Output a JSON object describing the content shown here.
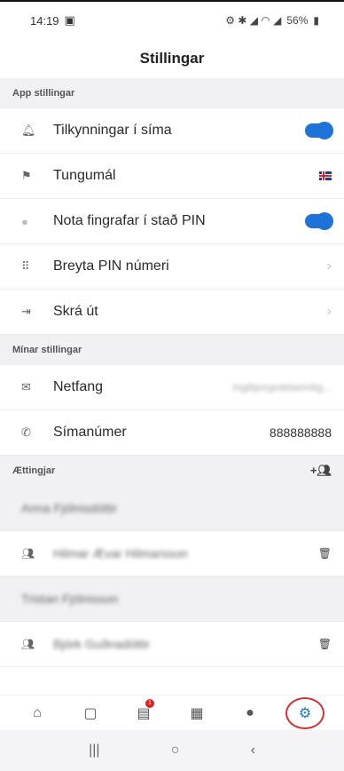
{
  "status": {
    "time": "14:19",
    "battery": "56%"
  },
  "header": {
    "title": "Stillingar"
  },
  "sections": {
    "app": "App stillingar",
    "minar": "Mínar stillingar",
    "aettingjar": "Ættingjar"
  },
  "app_settings": [
    {
      "label": "Tilkynningar í síma",
      "icon": "bell-icon"
    },
    {
      "label": "Tungumál",
      "icon": "flag-icon"
    },
    {
      "label": "Nota fingrafar í stað PIN",
      "icon": "fingerprint-icon"
    },
    {
      "label": "Breyta PIN númeri",
      "icon": "keypad-icon"
    },
    {
      "label": "Skrá út",
      "icon": "logout-icon"
    }
  ],
  "my_settings": [
    {
      "label": "Netfang",
      "value": "ingibjorgeddaeirdig...",
      "icon": "mail-icon"
    },
    {
      "label": "Símanúmer",
      "value": "888888888",
      "icon": "phone-icon"
    }
  ],
  "relatives": [
    {
      "name": "Anna Fjölnisdóttir"
    },
    {
      "name": "Hilmar Ævar Hilmarsson"
    },
    {
      "name": "Tristan Fjölnisson"
    },
    {
      "name": "Björk Guðnadóttir"
    }
  ],
  "tabs": [
    {
      "icon": "home-icon"
    },
    {
      "icon": "calendar-icon"
    },
    {
      "icon": "news-icon",
      "badge": "1"
    },
    {
      "icon": "gallery-icon"
    },
    {
      "icon": "chat-icon"
    },
    {
      "icon": "settings-icon"
    }
  ]
}
